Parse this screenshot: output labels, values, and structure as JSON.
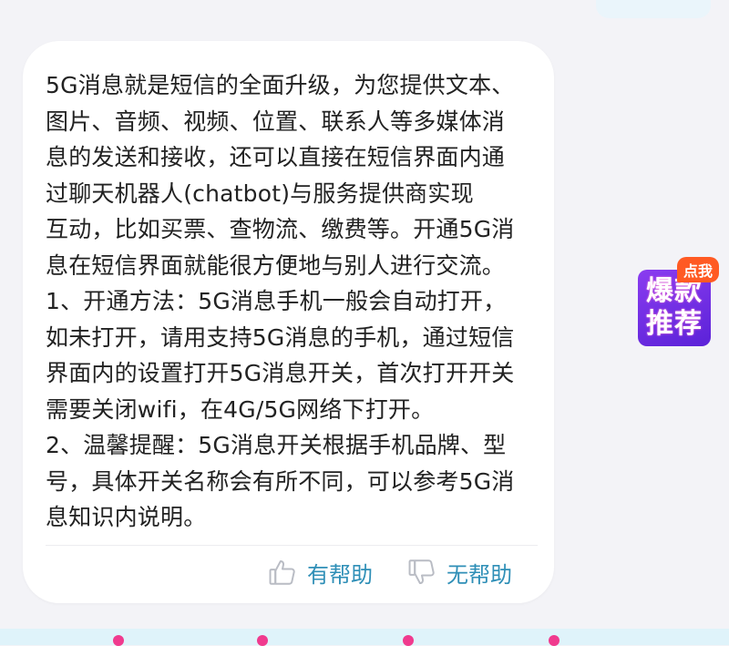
{
  "answer": {
    "lines": [
      "5G消息就是短信的全面升级，为您提供文本、",
      "图片、音频、视频、位置、联系人等多媒体消",
      "息的发送和接收，还可以直接在短信界面内通",
      "过聊天机器人(chatbot)与服务提供商实现",
      "互动，比如买票、查物流、缴费等。开通5G消",
      "息在短信界面就能很方便地与别人进行交流。",
      "1、开通方法：5G消息手机一般会自动打开，",
      "如未打开，请用支持5G消息的手机，通过短信",
      "界面内的设置打开5G消息开关，首次打开开关",
      "需要关闭wifi，在4G/5G网络下打开。",
      "2、温馨提醒：5G消息开关根据手机品牌、型",
      "号，具体开关名称会有所不同，可以参考5G消",
      "息知识内说明。"
    ]
  },
  "feedback": {
    "helpful_label": "有帮助",
    "unhelpful_label": "无帮助",
    "helpful_icon": "thumbs-up-icon",
    "unhelpful_icon": "thumbs-down-icon"
  },
  "promo": {
    "line1": "爆款",
    "line2": "推荐",
    "tag": "点我"
  },
  "colors": {
    "feedback_text": "#2f8fb7",
    "promo_bg": "#6a2be0",
    "promo_tag": "#ff5a23",
    "accent_dot": "#f03a8e"
  }
}
